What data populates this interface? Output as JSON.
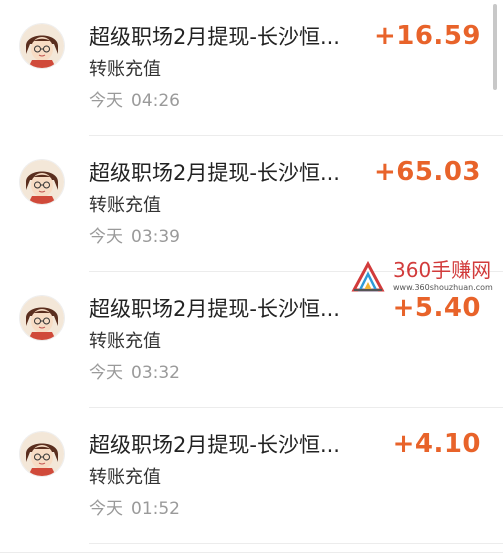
{
  "transactions": [
    {
      "title": "超级职场2月提现-长沙恒...",
      "type": "转账充值",
      "day": "今天",
      "time": "04:26",
      "amount": "+16.59"
    },
    {
      "title": "超级职场2月提现-长沙恒...",
      "type": "转账充值",
      "day": "今天",
      "time": "03:39",
      "amount": "+65.03"
    },
    {
      "title": "超级职场2月提现-长沙恒...",
      "type": "转账充值",
      "day": "今天",
      "time": "03:32",
      "amount": "+5.40"
    },
    {
      "title": "超级职场2月提现-长沙恒...",
      "type": "转账充值",
      "day": "今天",
      "time": "01:52",
      "amount": "+4.10"
    }
  ],
  "watermark": {
    "name": "360手赚网",
    "url": "www.360shouzhuan.com"
  },
  "colors": {
    "amount": "#e8632a",
    "title": "#222222",
    "time": "#9a9a9a"
  },
  "icons": {
    "avatar": "cartoon-avatar-icon",
    "logo": "360-logo-icon"
  }
}
